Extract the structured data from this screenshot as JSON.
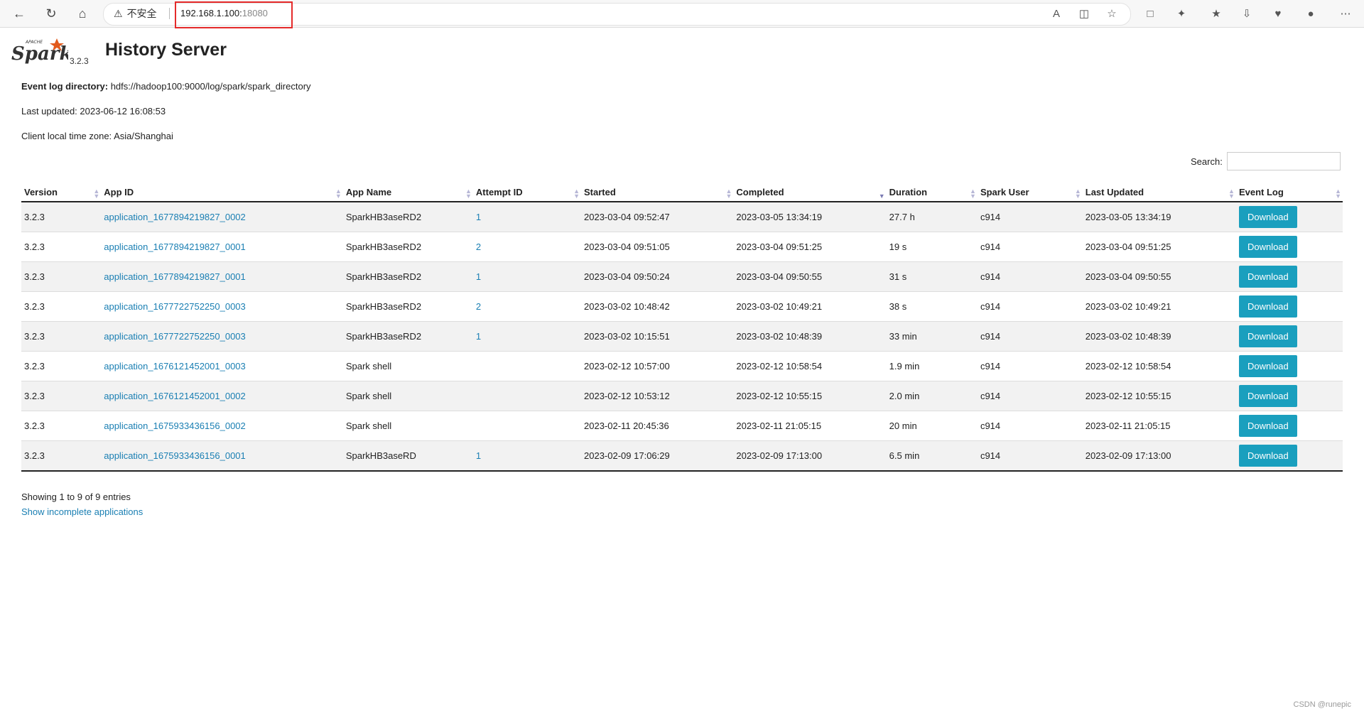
{
  "browser": {
    "insecure_label": "不安全",
    "url_host": "192.168.1.100:",
    "url_port": "18080"
  },
  "header": {
    "logo_text": "Spark",
    "logo_small": "APACHE",
    "version": "3.2.3",
    "title": "History Server"
  },
  "info": {
    "event_log_label": "Event log directory:",
    "event_log_value": " hdfs://hadoop100:9000/log/spark/spark_directory",
    "last_updated": "Last updated: 2023-06-12 16:08:53",
    "timezone": "Client local time zone: Asia/Shanghai"
  },
  "search": {
    "label": "Search:"
  },
  "table": {
    "columns": [
      "Version",
      "App ID",
      "App Name",
      "Attempt ID",
      "Started",
      "Completed",
      "Duration",
      "Spark User",
      "Last Updated",
      "Event Log"
    ],
    "rows": [
      [
        "3.2.3",
        "application_1677894219827_0002",
        "SparkHB3aseRD2",
        "1",
        "2023-03-04 09:52:47",
        "2023-03-05 13:34:19",
        "27.7 h",
        "c914",
        "2023-03-05 13:34:19",
        "Download"
      ],
      [
        "3.2.3",
        "application_1677894219827_0001",
        "SparkHB3aseRD2",
        "2",
        "2023-03-04 09:51:05",
        "2023-03-04 09:51:25",
        "19 s",
        "c914",
        "2023-03-04 09:51:25",
        "Download"
      ],
      [
        "3.2.3",
        "application_1677894219827_0001",
        "SparkHB3aseRD2",
        "1",
        "2023-03-04 09:50:24",
        "2023-03-04 09:50:55",
        "31 s",
        "c914",
        "2023-03-04 09:50:55",
        "Download"
      ],
      [
        "3.2.3",
        "application_1677722752250_0003",
        "SparkHB3aseRD2",
        "2",
        "2023-03-02 10:48:42",
        "2023-03-02 10:49:21",
        "38 s",
        "c914",
        "2023-03-02 10:49:21",
        "Download"
      ],
      [
        "3.2.3",
        "application_1677722752250_0003",
        "SparkHB3aseRD2",
        "1",
        "2023-03-02 10:15:51",
        "2023-03-02 10:48:39",
        "33 min",
        "c914",
        "2023-03-02 10:48:39",
        "Download"
      ],
      [
        "3.2.3",
        "application_1676121452001_0003",
        "Spark shell",
        "",
        "2023-02-12 10:57:00",
        "2023-02-12 10:58:54",
        "1.9 min",
        "c914",
        "2023-02-12 10:58:54",
        "Download"
      ],
      [
        "3.2.3",
        "application_1676121452001_0002",
        "Spark shell",
        "",
        "2023-02-12 10:53:12",
        "2023-02-12 10:55:15",
        "2.0 min",
        "c914",
        "2023-02-12 10:55:15",
        "Download"
      ],
      [
        "3.2.3",
        "application_1675933436156_0002",
        "Spark shell",
        "",
        "2023-02-11 20:45:36",
        "2023-02-11 21:05:15",
        "20 min",
        "c914",
        "2023-02-11 21:05:15",
        "Download"
      ],
      [
        "3.2.3",
        "application_1675933436156_0001",
        "SparkHB3aseRD",
        "1",
        "2023-02-09 17:06:29",
        "2023-02-09 17:13:00",
        "6.5 min",
        "c914",
        "2023-02-09 17:13:00",
        "Download"
      ]
    ]
  },
  "footer": {
    "showing": "Showing 1 to 9 of 9 entries",
    "incomplete_link": "Show incomplete applications"
  },
  "watermark": "CSDN @runepic"
}
